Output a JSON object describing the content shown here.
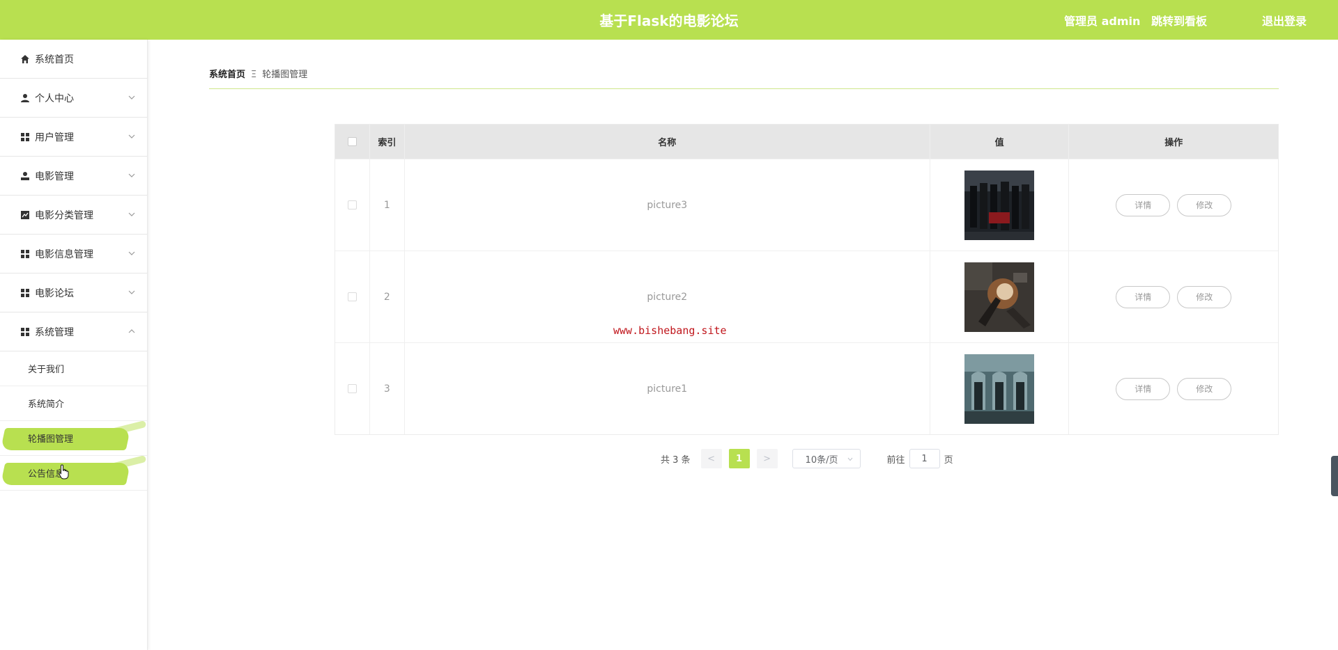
{
  "header": {
    "title": "基于Flask的电影论坛",
    "admin_label": "管理员 admin",
    "board_link": "跳转到看板",
    "logout_link": "退出登录"
  },
  "sidebar": {
    "items": [
      {
        "label": "系统首页",
        "icon": "home-icon"
      },
      {
        "label": "个人中心",
        "icon": "user-icon"
      },
      {
        "label": "用户管理",
        "icon": "grid-icon"
      },
      {
        "label": "电影管理",
        "icon": "person-icon"
      },
      {
        "label": "电影分类管理",
        "icon": "chart-icon"
      },
      {
        "label": "电影信息管理",
        "icon": "grid-icon"
      },
      {
        "label": "电影论坛",
        "icon": "grid-icon"
      },
      {
        "label": "系统管理",
        "icon": "grid-icon"
      }
    ],
    "sub_items": [
      {
        "label": "关于我们"
      },
      {
        "label": "系统简介"
      },
      {
        "label": "轮播图管理"
      },
      {
        "label": "公告信息"
      }
    ]
  },
  "breadcrumb": {
    "home": "系统首页",
    "separator": "Ξ",
    "current": "轮播图管理"
  },
  "table": {
    "headers": {
      "index": "索引",
      "name": "名称",
      "value": "值",
      "action": "操作"
    },
    "rows": [
      {
        "index": "1",
        "name": "picture3"
      },
      {
        "index": "2",
        "name": "picture2"
      },
      {
        "index": "3",
        "name": "picture1"
      }
    ],
    "detail_label": "详情",
    "edit_label": "修改"
  },
  "pagination": {
    "total": "共 3 条",
    "prev": "<",
    "current_page": "1",
    "next": ">",
    "page_size": "10条/页",
    "goto_prefix": "前往",
    "goto_value": "1",
    "goto_suffix": "页"
  },
  "watermark": "www.bishebang.site",
  "colors": {
    "accent": "#b8e050",
    "header_bg": "#b8e050",
    "table_head_bg": "#e6e6e6",
    "watermark": "#c0161c"
  }
}
